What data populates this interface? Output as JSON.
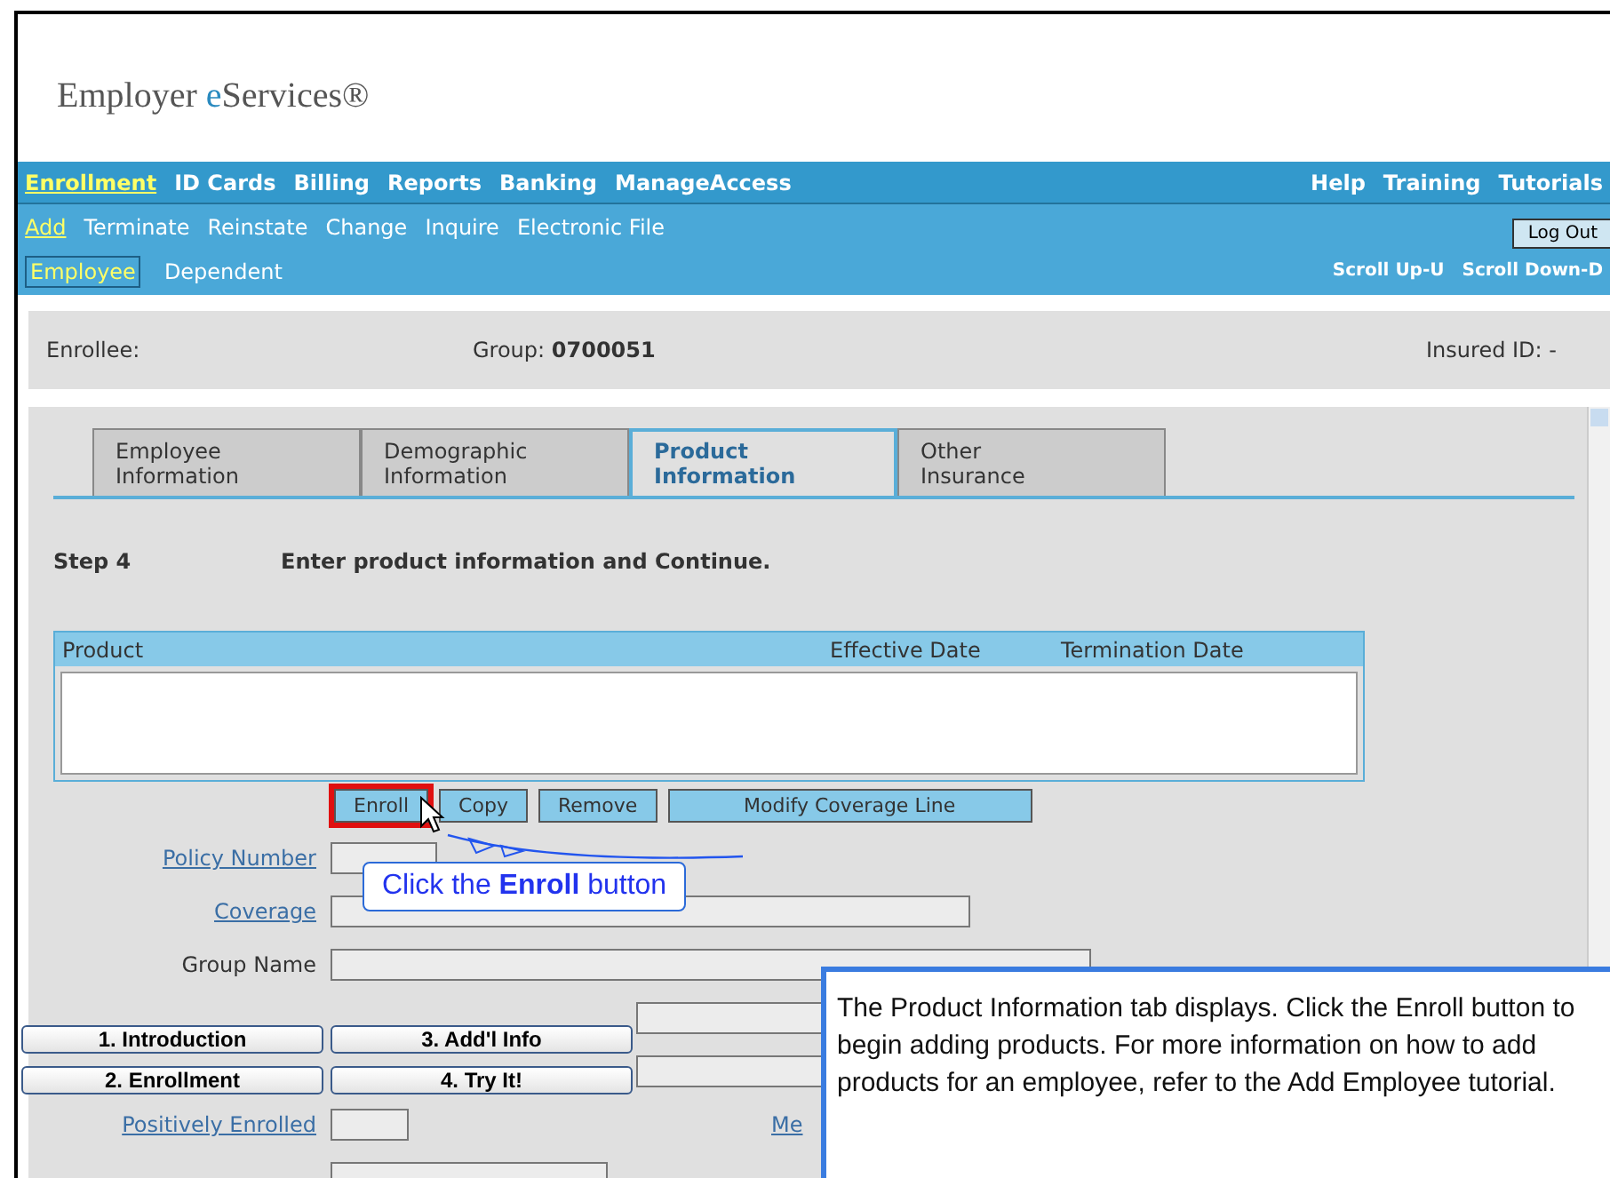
{
  "logo": {
    "parts": [
      "Employer ",
      "e",
      "Services®"
    ]
  },
  "main_menu": [
    {
      "label": "Enrollment",
      "selected": true
    },
    {
      "label": "ID Cards",
      "selected": false
    },
    {
      "label": "Billing",
      "selected": false
    },
    {
      "label": "Reports",
      "selected": false
    },
    {
      "label": "Banking",
      "selected": false
    },
    {
      "label": "ManageAccess",
      "selected": false
    }
  ],
  "help_menu": [
    "Help",
    "Training",
    "Tutorials"
  ],
  "action_menu": [
    {
      "label": "Add",
      "selected": true
    },
    {
      "label": "Terminate",
      "selected": false
    },
    {
      "label": "Reinstate",
      "selected": false
    },
    {
      "label": "Change",
      "selected": false
    },
    {
      "label": "Inquire",
      "selected": false
    },
    {
      "label": "Electronic File",
      "selected": false
    }
  ],
  "log_out": "Log Out",
  "person_menu": [
    {
      "label": "Employee",
      "selected": true
    },
    {
      "label": "Dependent",
      "selected": false
    }
  ],
  "scroll_links": [
    "Scroll Up-U",
    "Scroll Down-D"
  ],
  "enrollee_bar": {
    "enrollee_label": "Enrollee:",
    "group_label": "Group:",
    "group_value": "0700051",
    "insured_label": "Insured ID:",
    "insured_value": "-"
  },
  "tabs": [
    {
      "line1": "Employee",
      "line2": "Information",
      "selected": false
    },
    {
      "line1": "Demographic",
      "line2": "Information",
      "selected": false
    },
    {
      "line1": "Product",
      "line2": "Information",
      "selected": true
    },
    {
      "line1": "Other",
      "line2": "Insurance",
      "selected": false
    }
  ],
  "step": {
    "label": "Step 4",
    "instruction": "Enter product information and Continue."
  },
  "table": {
    "columns": [
      "Product",
      "Effective Date",
      "Termination Date"
    ]
  },
  "buttons": [
    {
      "label": "Enroll",
      "highlighted": true
    },
    {
      "label": "Copy",
      "highlighted": false
    },
    {
      "label": "Remove",
      "highlighted": false
    },
    {
      "label": "Modify Coverage Line",
      "highlighted": false
    }
  ],
  "fields": [
    {
      "label": "Policy Number",
      "kind": "link"
    },
    {
      "label": "Coverage",
      "kind": "link"
    },
    {
      "label": "Group Name",
      "kind": "plain"
    },
    {
      "kind": "hidden"
    },
    {
      "kind": "hidden"
    },
    {
      "label": "Positively Enrolled",
      "kind": "link",
      "side_link": "Me"
    },
    {
      "kind": "hidden"
    }
  ],
  "callout": "Click the **Enroll** button",
  "tutorial_nav": [
    "1. Introduction",
    "3. Add'l Info",
    "2. Enrollment",
    "4. Try It!"
  ],
  "tutorial_text": "The Product Information tab displays.  Click the Enroll button to begin adding products.  For more information on how to add products for an employee, refer to the Add Employee tutorial."
}
